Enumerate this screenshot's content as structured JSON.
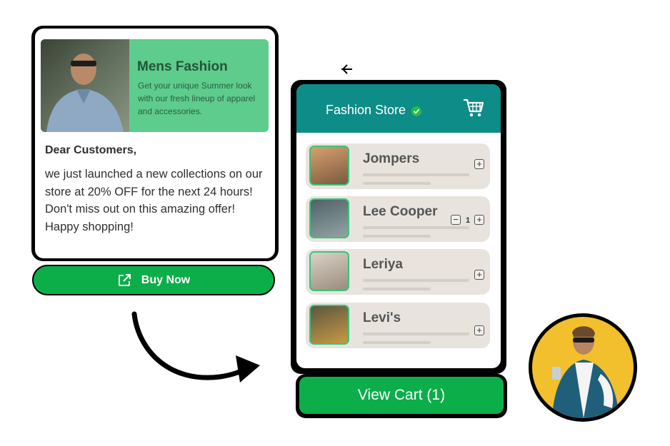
{
  "promo": {
    "title": "Mens Fashion",
    "text": "Get your unique Summer look with our fresh lineup of apparel and accessories."
  },
  "message": {
    "greeting": "Dear Customers,",
    "body": "we just launched a new collections on our store at 20% OFF for the next 24 hours! Don't miss out on this amazing offer!",
    "closing": "Happy shopping!"
  },
  "buy_button": {
    "label": "Buy Now",
    "icon": "external-link-icon"
  },
  "store": {
    "title": "Fashion Store",
    "verified_icon": "check-badge-icon",
    "cart_icon": "shopping-cart-icon",
    "items": [
      {
        "name": "Jompers",
        "quantity": null,
        "controls": [
          "add"
        ]
      },
      {
        "name": "Lee Cooper",
        "quantity": "1",
        "controls": [
          "remove",
          "add"
        ]
      },
      {
        "name": "Leriya",
        "quantity": null,
        "controls": [
          "add"
        ]
      },
      {
        "name": "Levi's",
        "quantity": null,
        "controls": [
          "add"
        ]
      }
    ]
  },
  "view_cart": {
    "label": "View Cart (1)"
  },
  "colors": {
    "accent_green": "#0cae4a",
    "promo_green": "#5dcc8c",
    "header_teal": "#0e8c87",
    "avatar_yellow": "#f2bf2d"
  }
}
